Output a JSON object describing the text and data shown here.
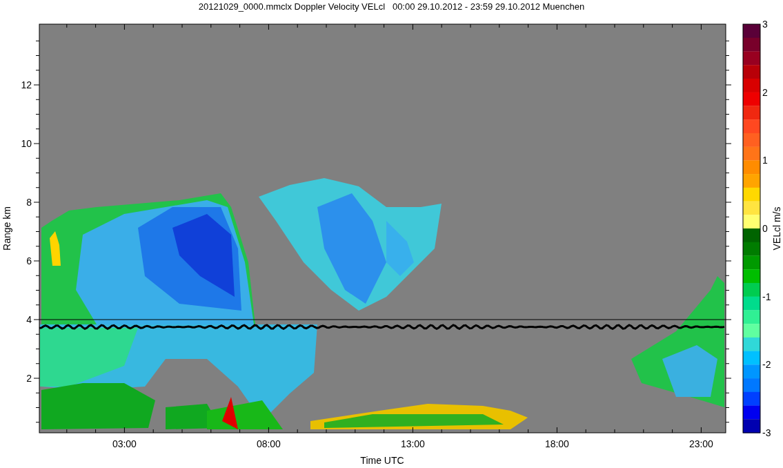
{
  "title": "20121029_0000.mmclx Doppler Velocity VELcl   00:00 29.10.2012 - 23:59 29.10.2012 Muenchen",
  "y_axis": {
    "label": "Range km",
    "ticks": [
      "12",
      "10",
      "8",
      "6",
      "4",
      "2"
    ]
  },
  "x_axis": {
    "label": "Time UTC",
    "ticks": [
      "03:00",
      "08:00",
      "13:00",
      "18:00",
      "23:00"
    ]
  },
  "colorbar": {
    "label": "VELcl m/s",
    "ticks": [
      "3",
      "2",
      "1",
      "0",
      "-1",
      "-2",
      "-3"
    ],
    "bands": [
      {
        "color": "#5a0038"
      },
      {
        "color": "#78002a"
      },
      {
        "color": "#980020"
      },
      {
        "color": "#b80008"
      },
      {
        "color": "#d80000"
      },
      {
        "color": "#ee0000"
      },
      {
        "color": "#f02810"
      },
      {
        "color": "#ff4820"
      },
      {
        "color": "#ff6020"
      },
      {
        "color": "#ff7418"
      },
      {
        "color": "#ff8c00"
      },
      {
        "color": "#ffa400"
      },
      {
        "color": "#ffd800"
      },
      {
        "color": "#ffe440"
      },
      {
        "color": "#ffff70"
      },
      {
        "color": "#006400"
      },
      {
        "color": "#007c00"
      },
      {
        "color": "#009a00"
      },
      {
        "color": "#00be00"
      },
      {
        "color": "#00cc50"
      },
      {
        "color": "#00dc8c"
      },
      {
        "color": "#30f094"
      },
      {
        "color": "#60ffa0"
      },
      {
        "color": "#30d8d8"
      },
      {
        "color": "#00c0ff"
      },
      {
        "color": "#0096ff"
      },
      {
        "color": "#0078ff"
      },
      {
        "color": "#0040ff"
      },
      {
        "color": "#0000f0"
      },
      {
        "color": "#0000b0"
      }
    ]
  }
}
